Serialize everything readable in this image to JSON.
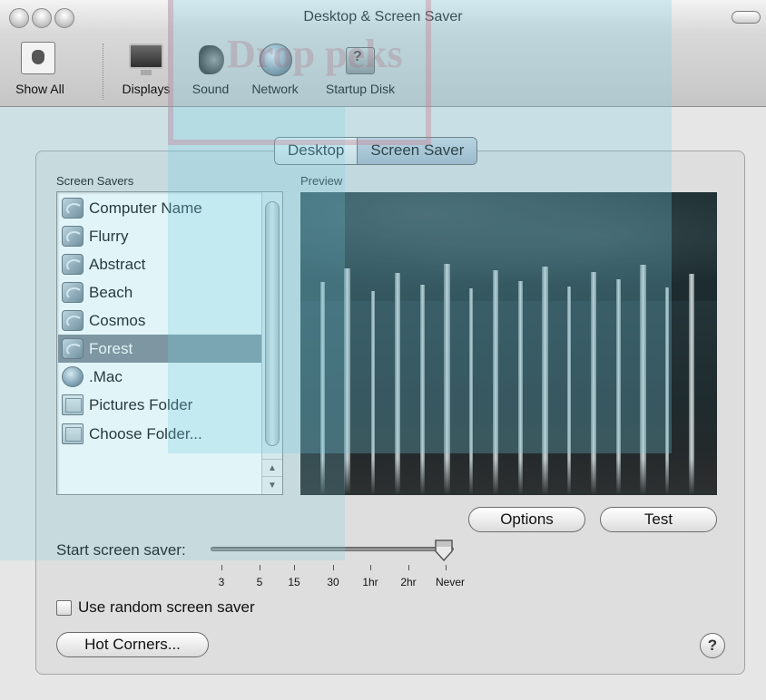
{
  "window": {
    "title": "Desktop & Screen Saver"
  },
  "toolbar": {
    "items": [
      {
        "label": "Show All",
        "icon": "show-all-icon"
      },
      {
        "label": "Displays",
        "icon": "display-icon"
      },
      {
        "label": "Sound",
        "icon": "speaker-icon"
      },
      {
        "label": "Network",
        "icon": "globe-icon"
      },
      {
        "label": "Startup Disk",
        "icon": "hard-disk-icon"
      }
    ]
  },
  "watermark": "Drop peks",
  "tabs": [
    {
      "label": "Desktop",
      "selected": false
    },
    {
      "label": "Screen Saver",
      "selected": true
    }
  ],
  "screen_savers": {
    "label": "Screen Savers",
    "items": [
      {
        "label": "Computer Name",
        "icon": "screensaver-icon"
      },
      {
        "label": "Flurry",
        "icon": "screensaver-icon"
      },
      {
        "label": "Abstract",
        "icon": "screensaver-icon"
      },
      {
        "label": "Beach",
        "icon": "screensaver-icon"
      },
      {
        "label": "Cosmos",
        "icon": "screensaver-icon"
      },
      {
        "label": "Forest",
        "icon": "screensaver-icon"
      },
      {
        "label": ".Mac",
        "icon": "mac-globe-icon"
      },
      {
        "label": "Pictures Folder",
        "icon": "folder-icon"
      },
      {
        "label": "Choose Folder...",
        "icon": "folder-icon"
      }
    ],
    "selected": "Forest"
  },
  "preview": {
    "label": "Preview"
  },
  "buttons": {
    "options": "Options",
    "test": "Test",
    "hot_corners": "Hot Corners...",
    "help": "?"
  },
  "start_screen_saver": {
    "label": "Start screen saver:",
    "ticks": [
      "3",
      "5",
      "15",
      "30",
      "1hr",
      "2hr",
      "Never"
    ],
    "value": "Never"
  },
  "random": {
    "label": "Use random screen saver",
    "checked": false
  },
  "colors": {
    "selection": "#7f8790",
    "preview_bg": "#1f2b2e",
    "watermark": "#78cde1"
  }
}
